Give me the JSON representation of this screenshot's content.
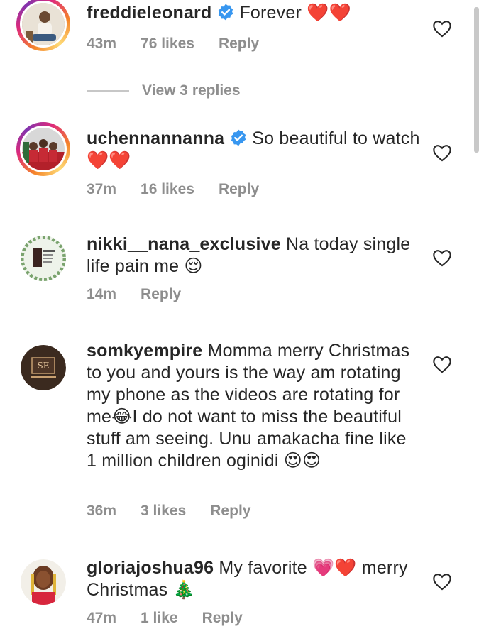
{
  "comments": [
    {
      "username": "freddieleonard",
      "verified": true,
      "text": "Forever ❤️❤️",
      "time": "43m",
      "likes": "76 likes",
      "reply": "Reply",
      "view_replies": "View 3 replies"
    },
    {
      "username": "uchennannanna",
      "verified": true,
      "text": "So beautiful to watch ❤️❤️",
      "time": "37m",
      "likes": "16 likes",
      "reply": "Reply"
    },
    {
      "username": "nikki__nana_exclusive",
      "verified": false,
      "text": "Na today single life pain me 😌",
      "time": "14m",
      "reply": "Reply"
    },
    {
      "username": "somkyempire",
      "verified": false,
      "text": "Momma merry Christmas to you and yours is the way am rotating my phone as the videos are rotating for me😂I do not want to miss the beautiful stuff am seeing. Unu amakacha fine like 1 million children oginidi 😍😍",
      "time": "36m",
      "likes": "3 likes",
      "reply": "Reply"
    },
    {
      "username": "gloriajoshua96",
      "verified": false,
      "text": "My favorite 💗❤️ merry Christmas 🎄",
      "time": "47m",
      "likes": "1 like",
      "reply": "Reply"
    }
  ],
  "icons": {
    "verified": "verified-badge-icon",
    "like": "heart-outline-icon"
  },
  "colors": {
    "verified_blue": "#3897f0",
    "meta_gray": "#8e8e8e",
    "text": "#262626"
  }
}
